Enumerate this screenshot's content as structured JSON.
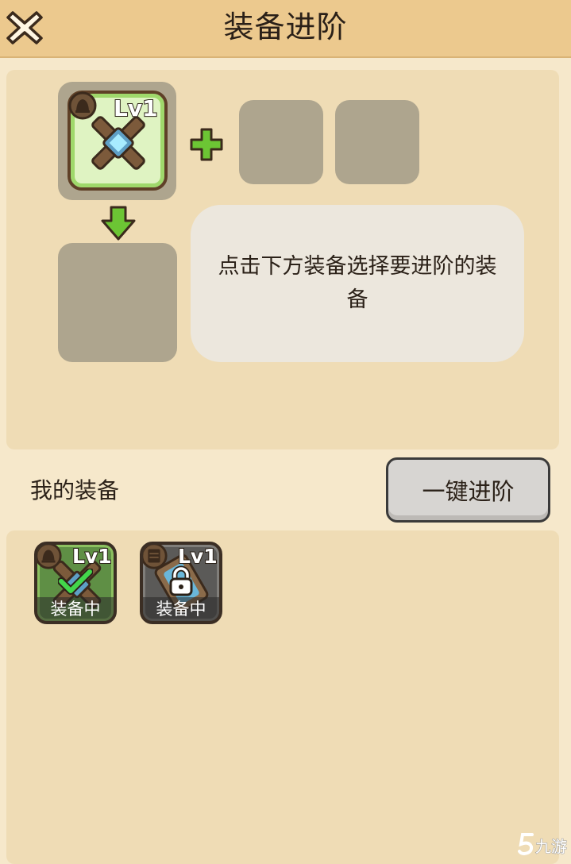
{
  "header": {
    "title": "装备进阶",
    "close_icon": "close-x-icon"
  },
  "upgrade": {
    "main_item": {
      "level": "Lv1",
      "rarity_icon": "bell-icon",
      "item_icon": "cross-weapon-icon"
    },
    "plus_icon": "plus-icon",
    "arrow_icon": "arrow-down-icon",
    "material_slots": [
      "",
      ""
    ],
    "result_slot": "",
    "tip": "点击下方装备选择要进阶的装备"
  },
  "inventory": {
    "label": "我的装备",
    "one_key_button": "一键进阶",
    "items": [
      {
        "level": "Lv1",
        "status": "装备中",
        "rarity_icon": "bell-icon",
        "item_icon": "cross-weapon-icon",
        "state_icon": "checkmark-icon",
        "color": "#5f8f45"
      },
      {
        "level": "Lv1",
        "status": "装备中",
        "rarity_icon": "book-icon",
        "item_icon": "scroll-icon",
        "state_icon": "lock-icon",
        "color": "#5b5a58"
      }
    ]
  },
  "colors": {
    "header_bg": "#ecc98e",
    "page_bg": "#f6e8cb",
    "panel_bg": "#efdcb5",
    "accent_green": "#6cc534",
    "slot_gray": "#aea58e"
  },
  "watermark": {
    "text": "九游"
  }
}
